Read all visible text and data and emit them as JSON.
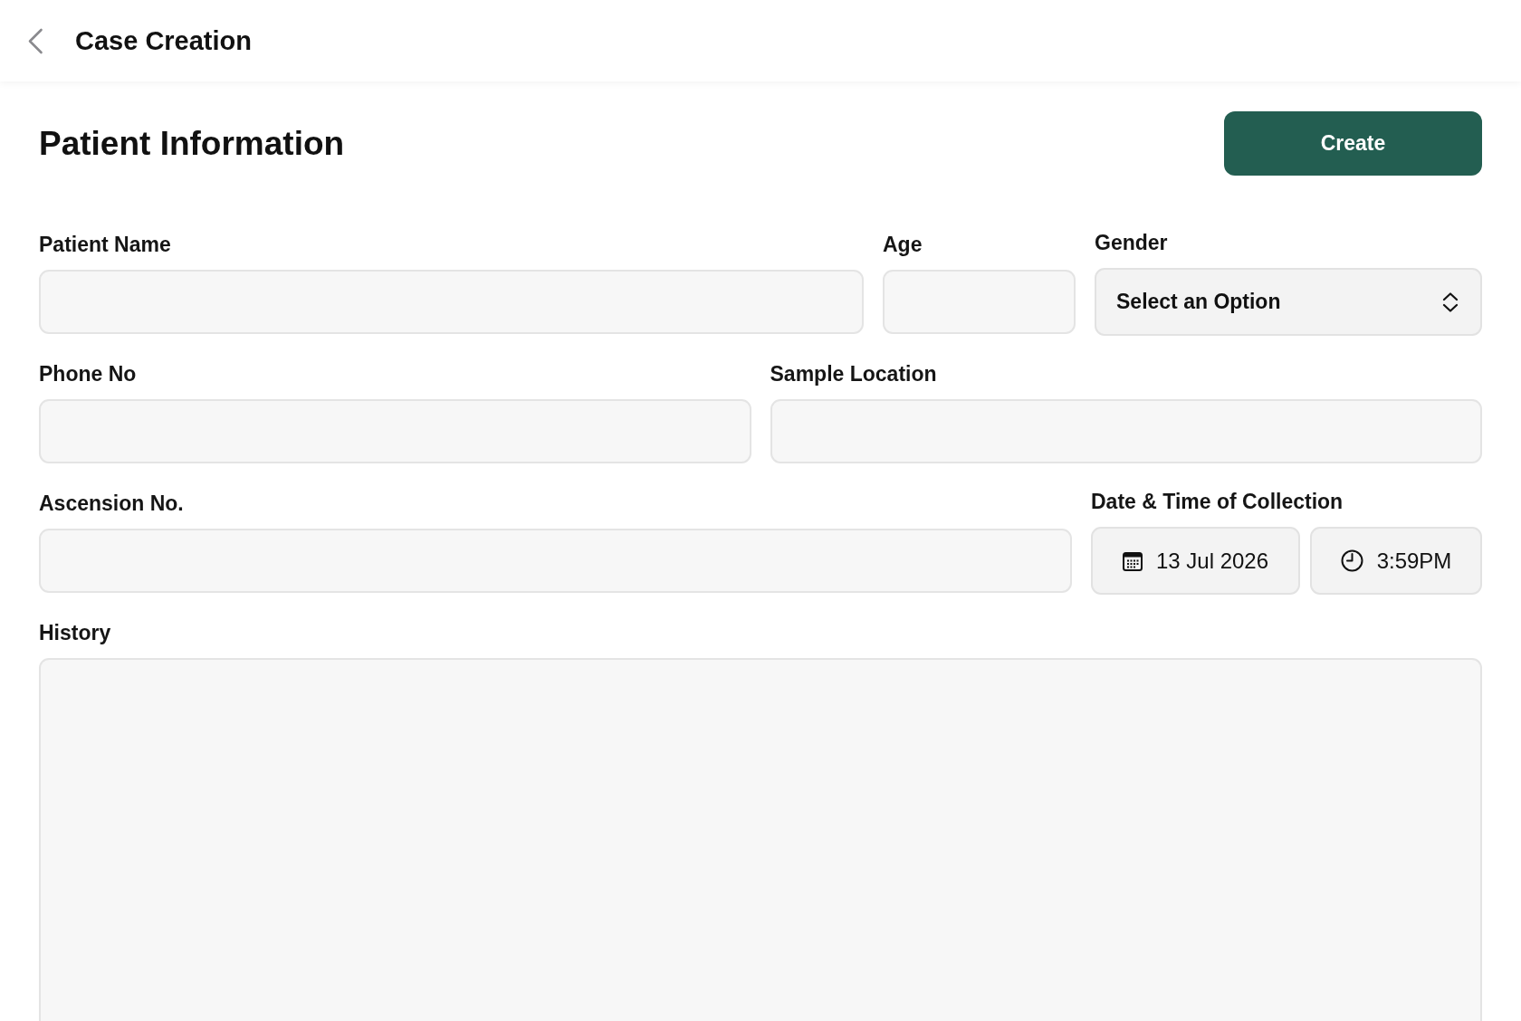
{
  "header": {
    "title": "Case Creation"
  },
  "page_title": "Patient Information",
  "create_button": {
    "label": "Create"
  },
  "rows": [
    {
      "fields": [
        {
          "kind": "text",
          "label": "Patient Name"
        },
        {
          "kind": "text",
          "label": "Age"
        },
        {
          "kind": "select",
          "label": "Gender",
          "placeholder": "Select an Option"
        }
      ]
    },
    {
      "fields": [
        {
          "kind": "text",
          "label": "Phone No"
        },
        {
          "kind": "text",
          "label": "Sample Location"
        }
      ]
    },
    {
      "fields": [
        {
          "kind": "text",
          "label": "Ascension No."
        },
        {
          "kind": "datetime",
          "label": "Date & Time of Collection",
          "date": "13 Jul 2026",
          "time": "3:59PM"
        }
      ]
    },
    {
      "fields": [
        {
          "kind": "textarea",
          "label": "History"
        }
      ]
    }
  ]
}
